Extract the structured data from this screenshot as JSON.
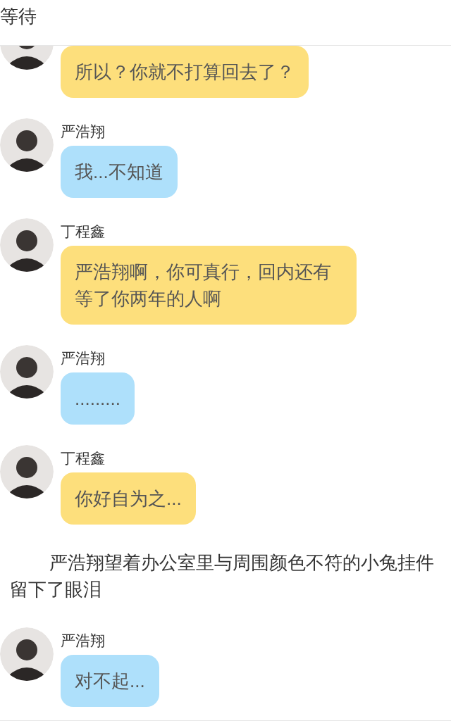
{
  "header": {
    "title": "等待"
  },
  "messages": [
    {
      "kind": "message",
      "color": "#fddf7c",
      "text": "所以？你就不打算回去了？"
    },
    {
      "kind": "message",
      "sender": "严浩翔",
      "color": "#aee0fb",
      "text": "我...不知道"
    },
    {
      "kind": "message",
      "sender": "丁程鑫",
      "color": "#fddf7c",
      "text": "严浩翔啊，你可真行，回内还有等了你两年的人啊"
    },
    {
      "kind": "message",
      "sender": "严浩翔",
      "color": "#aee0fb",
      "text": "........."
    },
    {
      "kind": "message",
      "sender": "丁程鑫",
      "color": "#fddf7c",
      "text": "你好自为之..."
    },
    {
      "kind": "narration",
      "text": "严浩翔望着办公室里与周围颜色不符的小兔挂件留下了眼泪"
    },
    {
      "kind": "message",
      "sender": "严浩翔",
      "color": "#aee0fb",
      "text": "对不起..."
    }
  ]
}
